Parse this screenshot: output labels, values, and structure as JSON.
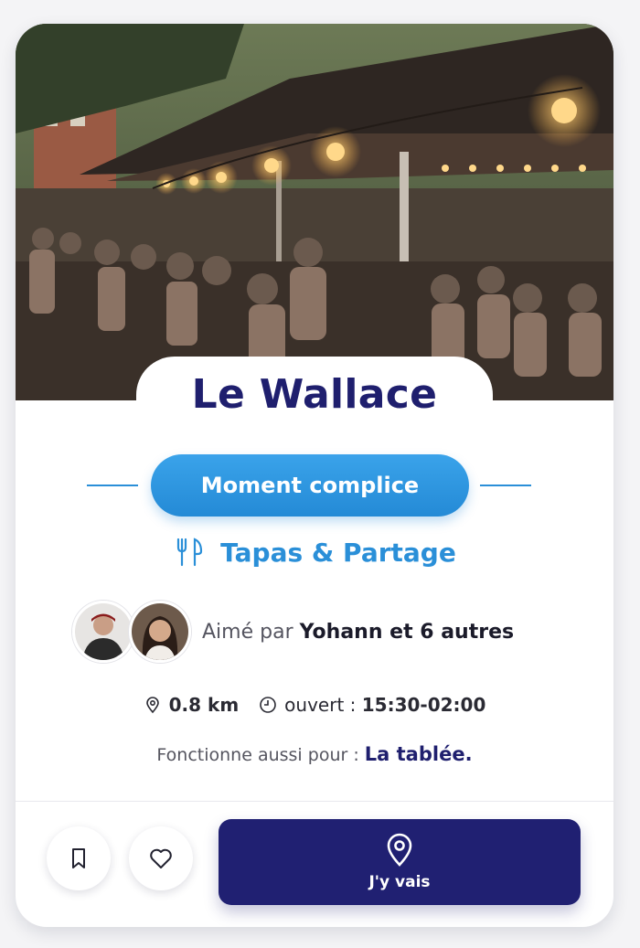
{
  "venue": {
    "name": "Le Wallace",
    "hero_image": "photo-terrasse-guinguette"
  },
  "badge": {
    "label": "Moment complice"
  },
  "category": {
    "icon": "fork-knife-icon",
    "label": "Tapas & Partage"
  },
  "social": {
    "prefix": "Aimé par",
    "names": "Yohann et 6 autres",
    "avatars": [
      "avatar-man-cap",
      "avatar-woman"
    ]
  },
  "info": {
    "distance": "0.8 km",
    "hours_prefix": "ouvert :",
    "hours": "15:30-02:00"
  },
  "also": {
    "prefix": "Fonctionne aussi pour :",
    "target": "La tablée."
  },
  "actions": {
    "go_label": "J'y vais",
    "bookmark_icon": "bookmark-icon",
    "favorite_icon": "heart-icon",
    "go_icon": "map-pin-icon"
  },
  "colors": {
    "navy": "#202072",
    "title": "#1f1f6e",
    "accent": "#2a8fd8"
  }
}
